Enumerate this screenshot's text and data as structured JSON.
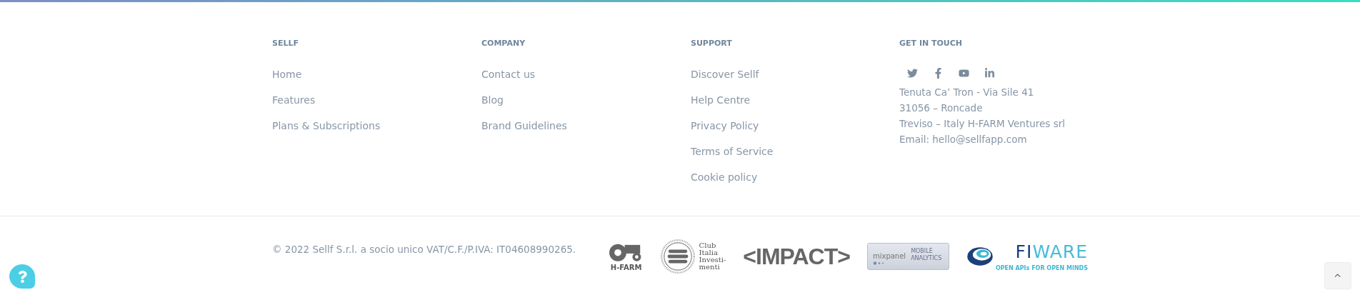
{
  "columns": [
    {
      "heading": "SELLF",
      "links": [
        "Home",
        "Features",
        "Plans & Subscriptions"
      ]
    },
    {
      "heading": "COMPANY",
      "links": [
        "Contact us",
        "Blog",
        "Brand Guidelines"
      ]
    },
    {
      "heading": "SUPPORT",
      "links": [
        "Discover Sellf",
        "Help Centre",
        "Privacy Policy",
        "Terms of Service",
        "Cookie policy"
      ]
    }
  ],
  "contact": {
    "heading": "GET IN TOUCH",
    "social": [
      {
        "kind": "twitter"
      },
      {
        "kind": "facebook"
      },
      {
        "kind": "youtube"
      },
      {
        "kind": "linkedin"
      }
    ],
    "address_lines": [
      "Tenuta Ca’ Tron - Via Sile 41",
      "31056 – Roncade",
      "Treviso – Italy H-FARM Ventures srl",
      "Email: hello@sellfapp.com"
    ]
  },
  "copyright": "© 2022 Sellf S.r.l. a socio unico VAT/C.F./P.IVA: IT04608990265.",
  "partner_logos": [
    {
      "kind": "hfarm",
      "texts": [
        "H-FARM"
      ]
    },
    {
      "kind": "club",
      "texts": [
        "Club",
        "Italia",
        "Investi-",
        "menti"
      ]
    },
    {
      "kind": "impact",
      "texts": [
        "<IMPACT>"
      ]
    },
    {
      "kind": "mixpanel",
      "texts": [
        "mixpanel",
        "MOBILE",
        "ANALYTICS"
      ]
    },
    {
      "kind": "fiware",
      "texts": [
        "FI",
        "WARE",
        "OPEN APIs FOR OPEN MINDS"
      ]
    }
  ]
}
